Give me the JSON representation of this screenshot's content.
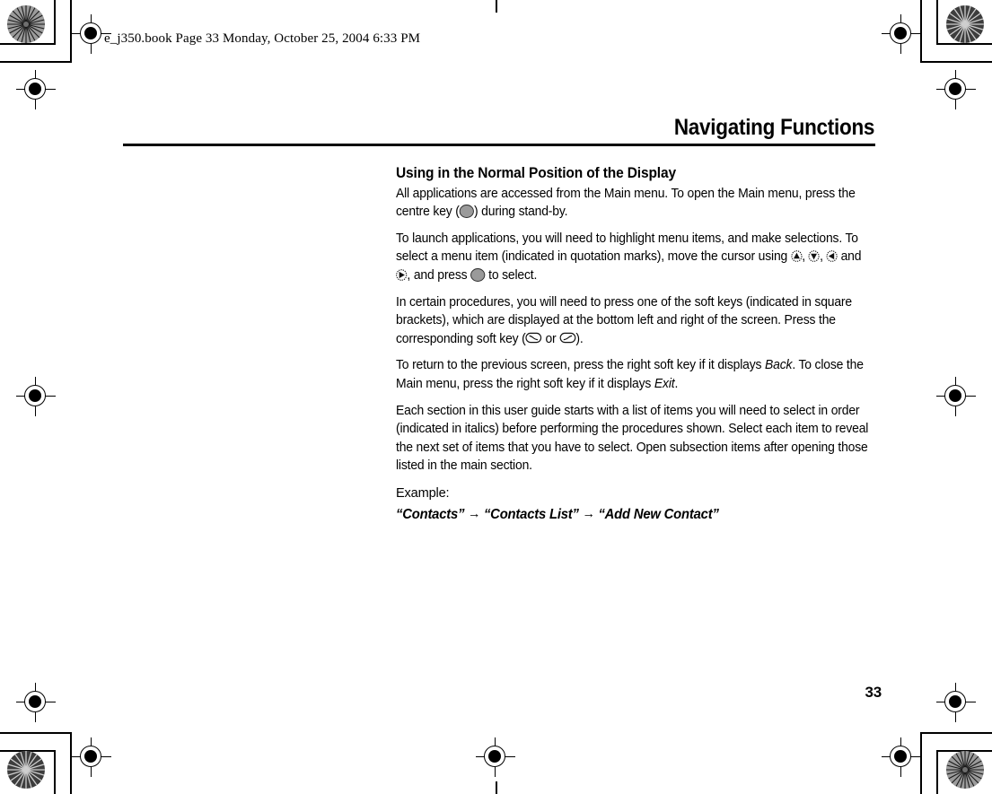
{
  "document": {
    "header_slug": "e_j350.book  Page 33  Monday, October 25, 2004  6:33 PM",
    "chapter_title": "Navigating Functions",
    "page_number": "33"
  },
  "section": {
    "heading": "Using in the Normal Position of the Display",
    "paragraphs": [
      {
        "id": "p1",
        "runs": [
          {
            "type": "text",
            "text": "All applications are accessed from the Main menu. To open the Main menu, press the centre key ("
          },
          {
            "type": "icon",
            "icon": "centre-key-icon"
          },
          {
            "type": "text",
            "text": ") during stand-by."
          }
        ]
      },
      {
        "id": "p2",
        "runs": [
          {
            "type": "text",
            "text": "To launch applications, you will need to highlight menu items, and make selections. To select a menu item (indicated in quotation marks), move the cursor using "
          },
          {
            "type": "icon",
            "icon": "navigate-up-icon"
          },
          {
            "type": "text",
            "text": ", "
          },
          {
            "type": "icon",
            "icon": "navigate-down-icon"
          },
          {
            "type": "text",
            "text": ", "
          },
          {
            "type": "icon",
            "icon": "navigate-left-icon"
          },
          {
            "type": "text",
            "text": " and "
          },
          {
            "type": "icon",
            "icon": "navigate-right-icon"
          },
          {
            "type": "text",
            "text": ", and press "
          },
          {
            "type": "icon",
            "icon": "centre-key-icon"
          },
          {
            "type": "text",
            "text": " to select."
          }
        ]
      },
      {
        "id": "p3",
        "runs": [
          {
            "type": "text",
            "text": "In certain procedures, you will need to press one of the soft keys (indicated in square brackets), which are displayed at the bottom left and right of the screen. Press the corresponding soft key ("
          },
          {
            "type": "icon",
            "icon": "left-soft-key-icon"
          },
          {
            "type": "text",
            "text": " or "
          },
          {
            "type": "icon",
            "icon": "right-soft-key-icon"
          },
          {
            "type": "text",
            "text": ")."
          }
        ]
      },
      {
        "id": "p4",
        "runs": [
          {
            "type": "text",
            "text": "To return to the previous screen, press the right soft key if it displays "
          },
          {
            "type": "italic",
            "text": "Back"
          },
          {
            "type": "text",
            "text": ". To close the Main menu, press the right soft key if it displays "
          },
          {
            "type": "italic",
            "text": "Exit"
          },
          {
            "type": "text",
            "text": "."
          }
        ]
      },
      {
        "id": "p5",
        "runs": [
          {
            "type": "text",
            "text": "Each section in this user guide starts with a list of items you will need to select in order (indicated in italics) before performing the procedures shown. Select each item to reveal the next set of items that you have to select. Open subsection items after opening those listed in the main section."
          }
        ]
      }
    ],
    "example_label": "Example:",
    "example_path": {
      "steps": [
        "“Contacts”",
        "“Contacts List”",
        "“Add New Contact”"
      ],
      "separator": "→"
    }
  },
  "print_marks": {
    "registration_target_label": "registration-target",
    "star_target_label": "star-density-target",
    "colors": {
      "ink": "#000000",
      "star_fill": "#8a8a8a",
      "key_fill": "#9a9a9a"
    }
  }
}
